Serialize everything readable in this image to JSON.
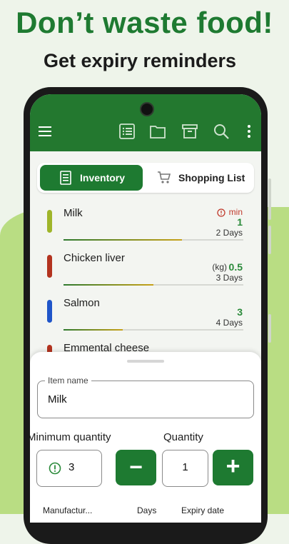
{
  "promo": {
    "headline": "Don’t waste food!",
    "subline": "Get expiry reminders"
  },
  "toolbar": {
    "icons": [
      "menu-icon",
      "list-icon",
      "folder-icon",
      "archive-icon",
      "search-icon",
      "more-vert-icon"
    ]
  },
  "tabs": {
    "inventory_label": "Inventory",
    "shopping_label": "Shopping List"
  },
  "items": [
    {
      "name": "Milk",
      "min_label": "min",
      "qty": "1",
      "days": "2 Days",
      "color": "#9fb52a",
      "freshness": 0.66
    },
    {
      "name": "Chicken liver",
      "unit": "(kg)",
      "qty": "0.5",
      "days": "3 Days",
      "color": "#b3331f",
      "freshness": 0.5
    },
    {
      "name": "Salmon",
      "qty": "3",
      "days": "4 Days",
      "color": "#1f55c9",
      "freshness": 0.33
    },
    {
      "name": "Emmental cheese",
      "color": "#b3331f"
    }
  ],
  "sheet": {
    "item_name_label": "Item name",
    "item_name_value": "Milk",
    "min_qty_label": "Minimum quantity",
    "min_qty_value": "3",
    "qty_label": "Quantity",
    "qty_value": "1",
    "minus_label": "−",
    "plus_label": "+",
    "manufactured_label": "Manufactur...",
    "days_label": "Days",
    "expiry_label": "Expiry date"
  },
  "colors": {
    "brand_green": "#1e7a31",
    "qty_green": "#2a8a3a",
    "alert_red": "#c0392b"
  }
}
